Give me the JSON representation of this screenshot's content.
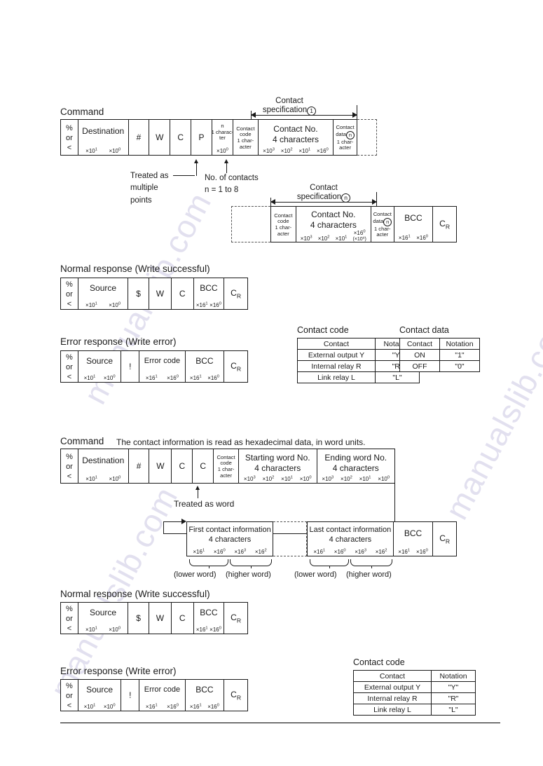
{
  "watermark": {
    "text": "manualslib.com"
  },
  "labels": {
    "percent_or_lt": [
      "%",
      "or",
      "<"
    ],
    "destination": "Destination",
    "source": "Source",
    "hash": "#",
    "W": "W",
    "C": "C",
    "P": "P",
    "dollar": "$",
    "bang": "!",
    "bcc": "BCC",
    "cr": "C",
    "cr_sub": "R",
    "error_code": "Error code",
    "x10_1": "×10",
    "x10_1_sup": "1",
    "x10_0": "×10",
    "x10_0_sup": "0",
    "x10_2_sup": "2",
    "x10_3_sup": "3",
    "x16_0": "×16",
    "x16_0_sup": "0",
    "x16_1": "×16",
    "x16_1_sup": "1",
    "x16_2_sup": "2",
    "x16_3_sup": "3"
  },
  "section1": {
    "command_title": "Command",
    "span_label_line1": "Contact",
    "span_label_line2": "specification",
    "span_label_badge": "1",
    "n_cell": {
      "line1": "n",
      "line2": "1 charac-",
      "line3": "ter",
      "sub": "×10⁰"
    },
    "contact_code_cell": {
      "line1": "Contact",
      "line2": "code",
      "line3": "1 char-",
      "line4": "acter"
    },
    "contact_no_cell": {
      "line1": "Contact No.",
      "line2": "4 characters"
    },
    "contact_data_cell": {
      "line1": "Contact",
      "line2": "data",
      "badge": "n",
      "line3": "1 char-",
      "line4": "acter"
    },
    "annot_multiple": [
      "Treated as",
      "multiple",
      "points"
    ],
    "annot_contacts": [
      "No. of contacts",
      "n = 1 to 8"
    ],
    "span2_label_line1": "Contact",
    "span2_label_line2": "specification",
    "span2_label_badge": "n",
    "contact_no_sub_alt": "(×10⁰)",
    "normal_title": "Normal response (Write successful)",
    "error_title": "Error response (Write error)"
  },
  "section2": {
    "command_title": "Command",
    "command_note": "The contact information is read as hexadecimal data, in word units.",
    "contact_code_cell": {
      "line1": "Contact",
      "line2": "code",
      "line3": "1 char-",
      "line4": "acter"
    },
    "starting_word": {
      "line1": "Starting word No.",
      "line2": "4 characters"
    },
    "ending_word": {
      "line1": "Ending word No.",
      "line2": "4 characters"
    },
    "annot_word": "Treated as word",
    "first_contact": {
      "line1": "First contact information",
      "line2": "4 characters"
    },
    "last_contact": {
      "line1": "Last contact information",
      "line2": "4 characters"
    },
    "lower_word": "(lower word)",
    "higher_word": "(higher word)",
    "normal_title": "Normal response (Write successful)",
    "error_title": "Error response (Write error)"
  },
  "contact_code_table": {
    "title": "Contact code",
    "headers": [
      "Contact",
      "Notation"
    ],
    "rows": [
      [
        "External output Y",
        "\"Y\""
      ],
      [
        "Internal relay R",
        "\"R\""
      ],
      [
        "Link relay L",
        "\"L\""
      ]
    ]
  },
  "contact_data_table": {
    "title": "Contact data",
    "headers": [
      "Contact",
      "Notation"
    ],
    "rows": [
      [
        "ON",
        "\"1\""
      ],
      [
        "OFF",
        "\"0\""
      ]
    ]
  }
}
